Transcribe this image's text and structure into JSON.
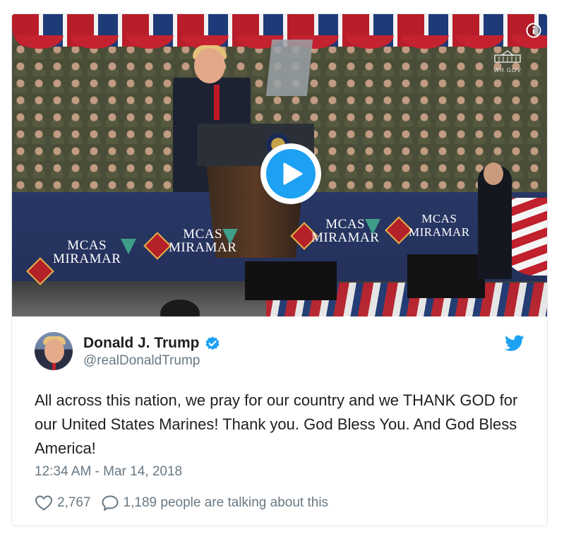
{
  "media": {
    "banner_labels": [
      {
        "line1": "MCAS",
        "line2": "MIRAMAR"
      },
      {
        "line1": "MCAS",
        "line2": "MIRAMAR"
      },
      {
        "line1": "MCAS",
        "line2": "MIRAMAR"
      },
      {
        "line1": "MCAS",
        "line2": "MIRAMAR"
      }
    ],
    "watermark": "WH.GOV",
    "play_icon": "play-icon",
    "info_icon": "info-icon"
  },
  "tweet": {
    "author_name": "Donald J. Trump",
    "handle": "@realDonaldTrump",
    "text": "All across this nation, we pray for our country and we THANK GOD for our United States Marines! Thank you. God Bless You. And God Bless America!",
    "timestamp": "12:34 AM - Mar 14, 2018",
    "like_count": "2,767",
    "talking_text": "1,189 people are talking about this"
  },
  "colors": {
    "accent": "#1da1f2",
    "text": "#1c2022",
    "muted": "#697882",
    "border": "#e1e8ed"
  }
}
